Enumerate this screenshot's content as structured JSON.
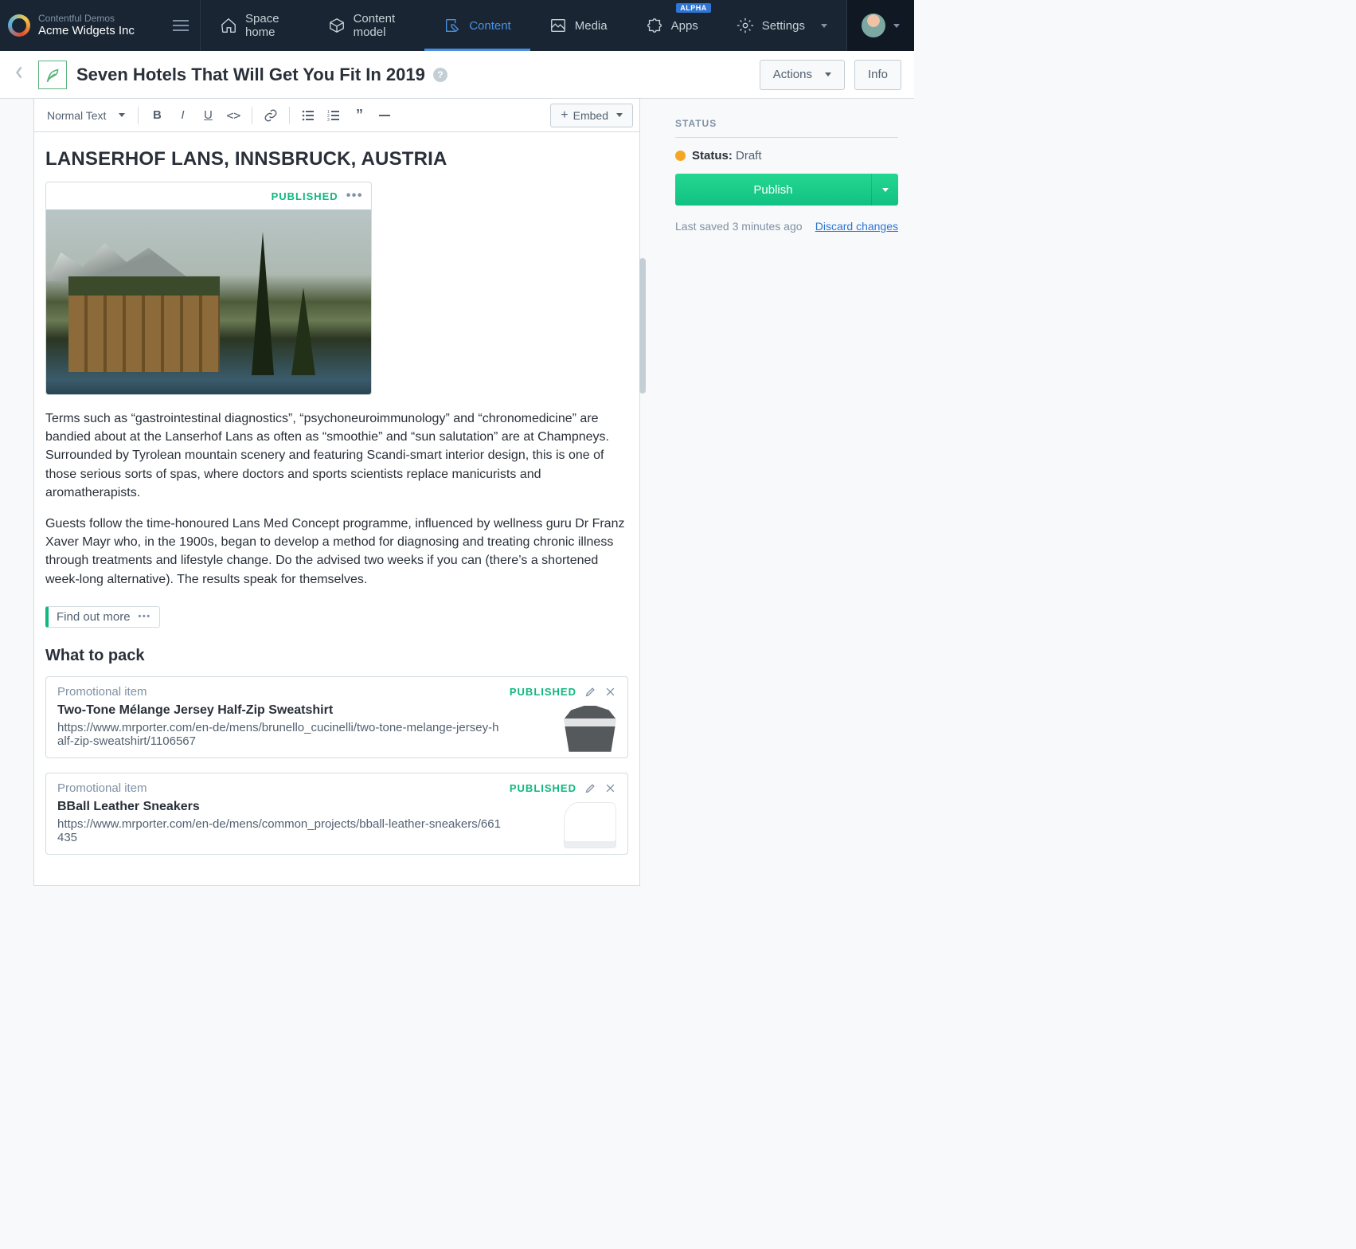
{
  "brand": {
    "subtitle": "Contentful Demos",
    "title": "Acme Widgets Inc"
  },
  "nav": {
    "space_home": "Space home",
    "content_model": "Content model",
    "content": "Content",
    "media": "Media",
    "apps": "Apps",
    "apps_badge": "ALPHA",
    "settings": "Settings"
  },
  "page": {
    "title": "Seven Hotels That Will Get You Fit In 2019",
    "actions": "Actions",
    "info": "Info"
  },
  "toolbar": {
    "style_select": "Normal Text",
    "embed": "Embed"
  },
  "article": {
    "heading1": "LANSERHOF LANS, INNSBRUCK, AUSTRIA",
    "image_status": "PUBLISHED",
    "p1": "Terms such as “gastrointestinal diagnostics”, “psychoneuroimmunology” and “chronomedicine” are bandied about at the Lanserhof Lans as often as “smoothie” and “sun salutation” are at Champneys. Surrounded by Tyrolean mountain scenery and featuring Scandi-smart interior design, this is one of those serious sorts of spas, where doctors and sports scientists replace manicurists and aromatherapists.",
    "p2": "Guests follow the time-honoured Lans Med Concept programme, influenced by wellness guru Dr Franz Xaver Mayr who, in the 1900s, began to develop a method for diagnosing and treating chronic illness through treatments and lifestyle change. Do the advised two weeks if you can (there’s a shortened week-long alternative). The results speak for themselves.",
    "find_more": "Find out more",
    "subheading": "What to pack"
  },
  "promos": [
    {
      "type": "Promotional item",
      "status": "PUBLISHED",
      "title": "Two-Tone Mélange Jersey Half-Zip Sweatshirt",
      "url": "https://www.mrporter.com/en-de/mens/brunello_cucinelli/two-tone-melange-jersey-half-zip-sweatshirt/1106567"
    },
    {
      "type": "Promotional item",
      "status": "PUBLISHED",
      "title": "BBall Leather Sneakers",
      "url": "https://www.mrporter.com/en-de/mens/common_projects/bball-leather-sneakers/661435"
    }
  ],
  "sidebar": {
    "heading": "STATUS",
    "status_label": "Status:",
    "status_value": "Draft",
    "publish": "Publish",
    "last_saved": "Last saved 3 minutes ago",
    "discard": "Discard changes"
  }
}
